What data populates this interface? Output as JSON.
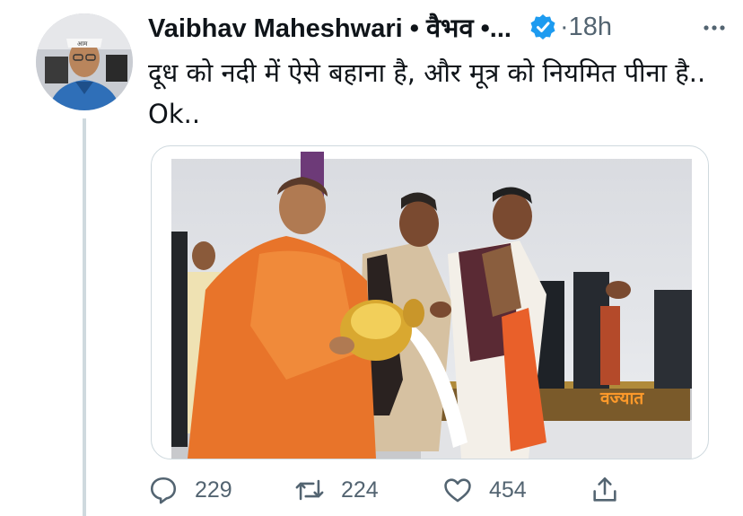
{
  "tweet": {
    "author_name": "Vaibhav Maheshwari • वैभव •...",
    "timestamp": "·18h",
    "text": "दूध को नदी में ऐसे बहाना है, और मूत्र को नियमित पीना है.. Ok..",
    "media_caption": "वज्यात"
  },
  "actions": {
    "replies": "229",
    "retweets": "224",
    "likes": "454"
  },
  "colors": {
    "verified": "#1d9bf0",
    "secondary_text": "#536471",
    "saffron_robe": "#e8742a"
  }
}
